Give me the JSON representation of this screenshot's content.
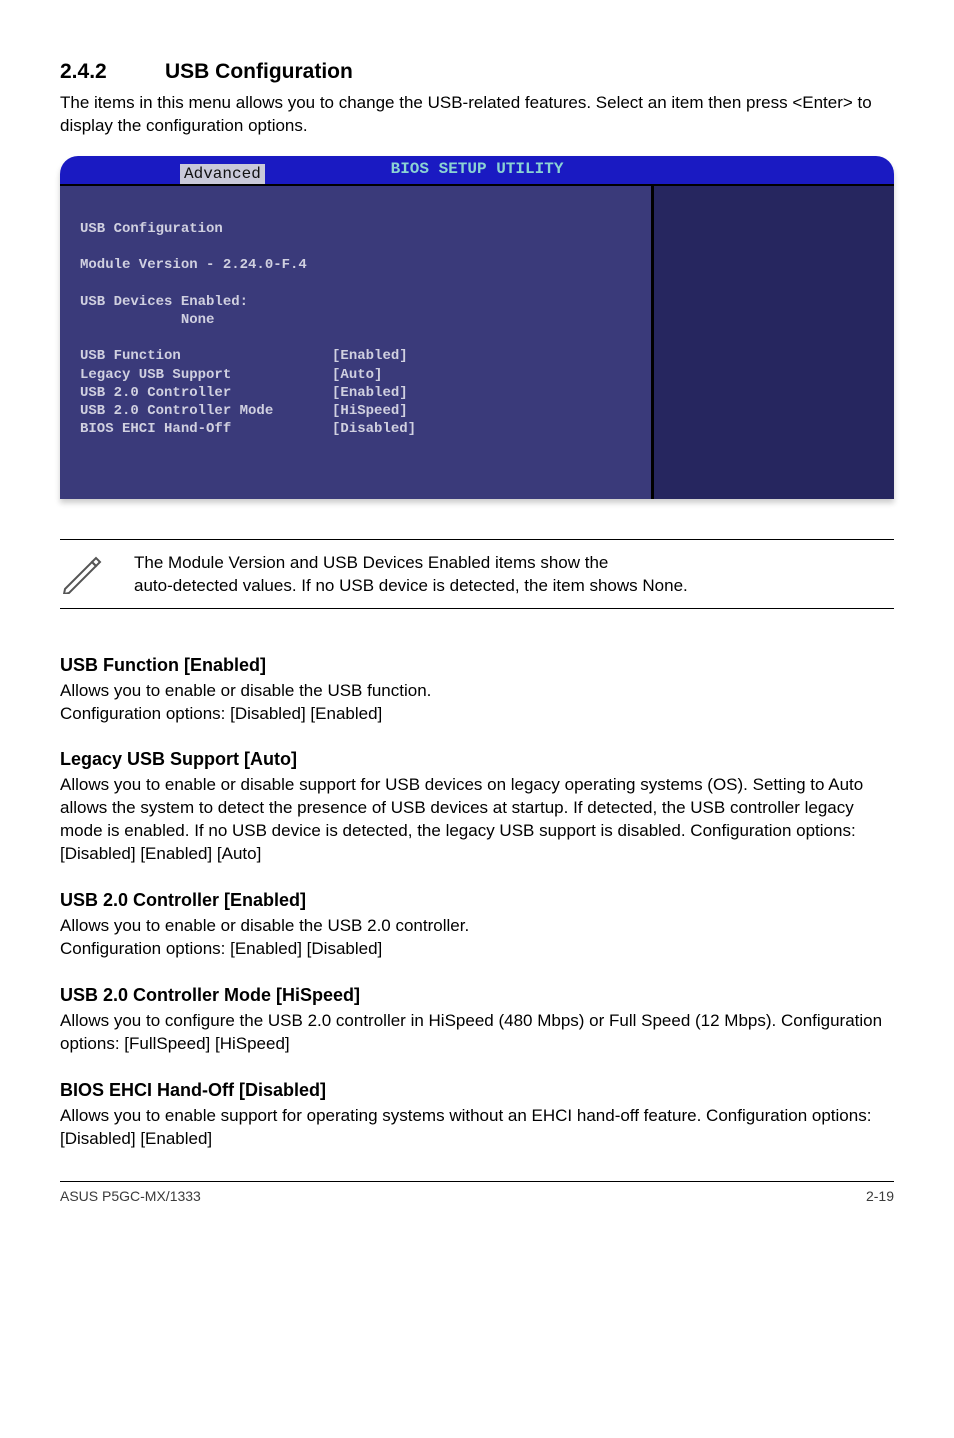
{
  "section": {
    "number": "2.4.2",
    "title": "USB Configuration",
    "intro": "The items in this menu allows you to change the USB-related features. Select an item then press <Enter> to display the configuration options."
  },
  "bios": {
    "header_title": "BIOS SETUP UTILITY",
    "tab": "Advanced",
    "config_header": "USB Configuration",
    "module_version": "Module Version - 2.24.0-F.4",
    "devices_header": "USB Devices Enabled:",
    "devices_state": "None",
    "items": [
      {
        "label": "USB Function",
        "value": "[Enabled]"
      },
      {
        "label": "Legacy USB Support",
        "value": "[Auto]"
      },
      {
        "label": "USB 2.0 Controller",
        "value": "[Enabled]"
      },
      {
        "label": "USB 2.0 Controller Mode",
        "value": "[HiSpeed]"
      },
      {
        "label": "BIOS EHCI Hand-Off",
        "value": "[Disabled]"
      }
    ]
  },
  "note": {
    "text_line1": "The Module Version and USB Devices Enabled items show the",
    "text_line2": "auto-detected values. If no USB device is detected, the item shows None."
  },
  "subsections": [
    {
      "heading": "USB Function [Enabled]",
      "body": "Allows you to enable or disable the USB function.\nConfiguration options: [Disabled] [Enabled]"
    },
    {
      "heading": "Legacy USB Support [Auto]",
      "body": "Allows you to enable or disable support for USB devices on legacy operating systems (OS). Setting to Auto allows the system to detect the presence of USB devices at startup. If detected, the USB controller legacy mode is enabled. If no USB device is detected, the legacy USB support is disabled. Configuration options: [Disabled] [Enabled] [Auto]"
    },
    {
      "heading": "USB 2.0 Controller [Enabled]",
      "body": "Allows you to enable or disable the USB 2.0 controller.\nConfiguration options: [Enabled] [Disabled]"
    },
    {
      "heading": "USB 2.0 Controller Mode [HiSpeed]",
      "body": "Allows you to configure the USB 2.0 controller in HiSpeed (480 Mbps) or Full Speed (12 Mbps). Configuration options: [FullSpeed] [HiSpeed]"
    },
    {
      "heading": "BIOS EHCI Hand-Off [Disabled]",
      "body": "Allows you to enable support for operating systems without an EHCI hand-off feature. Configuration options: [Disabled] [Enabled]"
    }
  ],
  "footer": {
    "left": "ASUS P5GC-MX/1333",
    "right": "2-19"
  },
  "icons": {
    "pencil": "pencil-icon"
  }
}
